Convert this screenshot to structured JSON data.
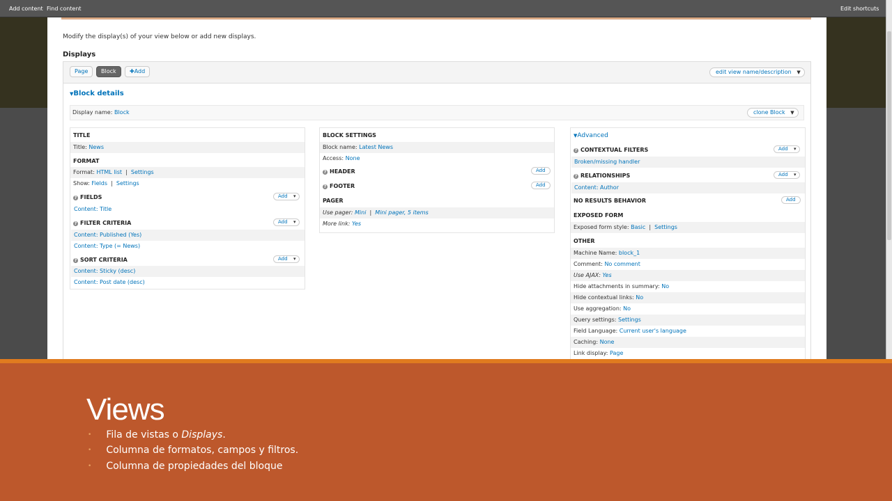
{
  "toolbar": {
    "add_content": "Add content",
    "find_content": "Find content",
    "edit_shortcuts": "Edit shortcuts"
  },
  "intro": "Modify the display(s) of your view below or add new displays.",
  "displays": {
    "heading": "Displays",
    "tabs": [
      "Page",
      "Block"
    ],
    "add_label": "Add",
    "edit_view_label": "edit view name/description"
  },
  "details": {
    "heading": "Block details",
    "display_name_label": "Display name:",
    "display_name_value": "Block",
    "clone_label": "clone Block"
  },
  "col1": {
    "title_h": "TITLE",
    "title_label": "Title:",
    "title_value": "News",
    "format_h": "FORMAT",
    "format_label": "Format:",
    "format_value": "HTML list",
    "format_settings": "Settings",
    "show_label": "Show:",
    "show_value": "Fields",
    "show_settings": "Settings",
    "fields_h": "FIELDS",
    "fields": [
      "Content: Title"
    ],
    "filter_h": "FILTER CRITERIA",
    "filters": [
      "Content: Published (Yes)",
      "Content: Type (= News)"
    ],
    "sort_h": "SORT CRITERIA",
    "sorts": [
      "Content: Sticky (desc)",
      "Content: Post date (desc)"
    ],
    "add": "Add"
  },
  "col2": {
    "block_settings_h": "BLOCK SETTINGS",
    "block_name_label": "Block name:",
    "block_name_value": "Latest News",
    "access_label": "Access:",
    "access_value": "None",
    "header_h": "HEADER",
    "footer_h": "FOOTER",
    "add": "Add",
    "pager_h": "PAGER",
    "use_pager_label": "Use pager:",
    "use_pager_value": "Mini",
    "use_pager_value2": "Mini pager, 5 items",
    "more_link_label": "More link:",
    "more_link_value": "Yes"
  },
  "col3": {
    "advanced": "Advanced",
    "contextual_h": "CONTEXTUAL FILTERS",
    "contextual_value": "Broken/missing handler",
    "relationships_h": "RELATIONSHIPS",
    "relationships_value": "Content: Author",
    "no_results_h": "NO RESULTS BEHAVIOR",
    "exposed_h": "EXPOSED FORM",
    "exposed_label": "Exposed form style:",
    "exposed_value": "Basic",
    "exposed_settings": "Settings",
    "other_h": "OTHER",
    "add": "Add",
    "other_rows": [
      {
        "label": "Machine Name:",
        "value": "block_1"
      },
      {
        "label": "Comment:",
        "value": "No comment"
      },
      {
        "label": "Use AJAX:",
        "value": "Yes"
      },
      {
        "label": "Hide attachments in summary:",
        "value": "No"
      },
      {
        "label": "Hide contextual links:",
        "value": "No"
      },
      {
        "label": "Use aggregation:",
        "value": "No"
      },
      {
        "label": "Query settings:",
        "value": "Settings"
      },
      {
        "label": "Field Language:",
        "value": "Current user's language"
      },
      {
        "label": "Caching:",
        "value": "None"
      },
      {
        "label": "Link display:",
        "value": "Page"
      }
    ]
  },
  "slide": {
    "title": "Views",
    "bullet1_pre": "Fila de vistas o ",
    "bullet1_em": "Displays",
    "bullet1_post": ".",
    "bullet2": "Columna de formatos, campos y filtros.",
    "bullet3": "Columna de propiedades del bloque"
  },
  "colors": {
    "link": "#0073ba",
    "slide_bg": "#bd582c",
    "slide_strip": "#e07b1f",
    "toolbar": "#555555"
  }
}
